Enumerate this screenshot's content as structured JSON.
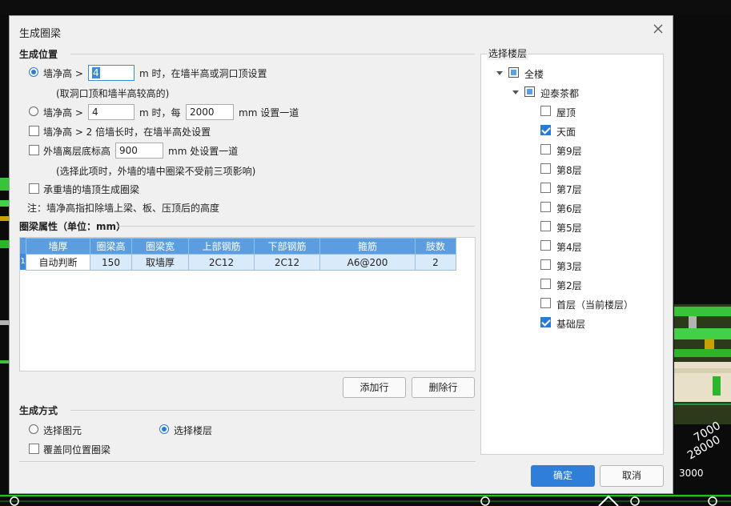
{
  "dialog": {
    "title": "生成圈梁",
    "generate_position": {
      "section_title": "生成位置",
      "opt1_label": "墙净高 >",
      "opt1_value": "4",
      "opt1_suffix": "m 时，在墙半高或洞口顶设置",
      "opt1_note": "(取洞口顶和墙半高较高的)",
      "opt2_label": "墙净高 >",
      "opt2_value": "4",
      "opt2_mid": "m 时，每",
      "opt2_every": "2000",
      "opt2_suffix": "mm 设置一道",
      "opt3_label": "墙净高 > 2 倍墙长时，在墙半高处设置",
      "opt4_label": "外墙离层底标高",
      "opt4_value": "900",
      "opt4_suffix": "mm 处设置一道",
      "opt4_note": "(选择此项时，外墙的墙中圈梁不受前三项影响)",
      "opt5_label": "承重墙的墙顶生成圈梁",
      "footnote": "注：墙净高指扣除墙上梁、板、压顶后的高度"
    },
    "beam_props": {
      "section_title": "圈梁属性（单位：mm）",
      "columns": [
        "墙厚",
        "圈梁高",
        "圈梁宽",
        "上部钢筋",
        "下部钢筋",
        "箍筋",
        "肢数"
      ],
      "rows": [
        {
          "num": "1",
          "cells": [
            "自动判断",
            "150",
            "取墙厚",
            "2C12",
            "2C12",
            "A6@200",
            "2"
          ]
        }
      ],
      "add_row": "添加行",
      "delete_row": "删除行"
    },
    "generate_mode": {
      "section_title": "生成方式",
      "select_element": "选择图元",
      "select_floor": "选择楼层",
      "overwrite": "覆盖同位置圈梁"
    },
    "floor_select": {
      "legend": "选择楼层",
      "all_floors": "全楼",
      "building": "迎泰茶都",
      "floors": [
        {
          "label": "屋顶",
          "checked": false
        },
        {
          "label": "天面",
          "checked": true
        },
        {
          "label": "第9层",
          "checked": false
        },
        {
          "label": "第8层",
          "checked": false
        },
        {
          "label": "第7层",
          "checked": false
        },
        {
          "label": "第6层",
          "checked": false
        },
        {
          "label": "第5层",
          "checked": false
        },
        {
          "label": "第4层",
          "checked": false
        },
        {
          "label": "第3层",
          "checked": false
        },
        {
          "label": "第2层",
          "checked": false
        },
        {
          "label": "首层（当前楼层）",
          "checked": false
        },
        {
          "label": "基础层",
          "checked": true
        }
      ]
    },
    "ok": "确定",
    "cancel": "取消"
  },
  "background": {
    "labels": [
      "7000",
      "28000",
      "3000"
    ]
  },
  "colors": {
    "accent": "#2f7ed8",
    "table_header": "#5b9ddf",
    "table_row": "#d9ebfb"
  }
}
